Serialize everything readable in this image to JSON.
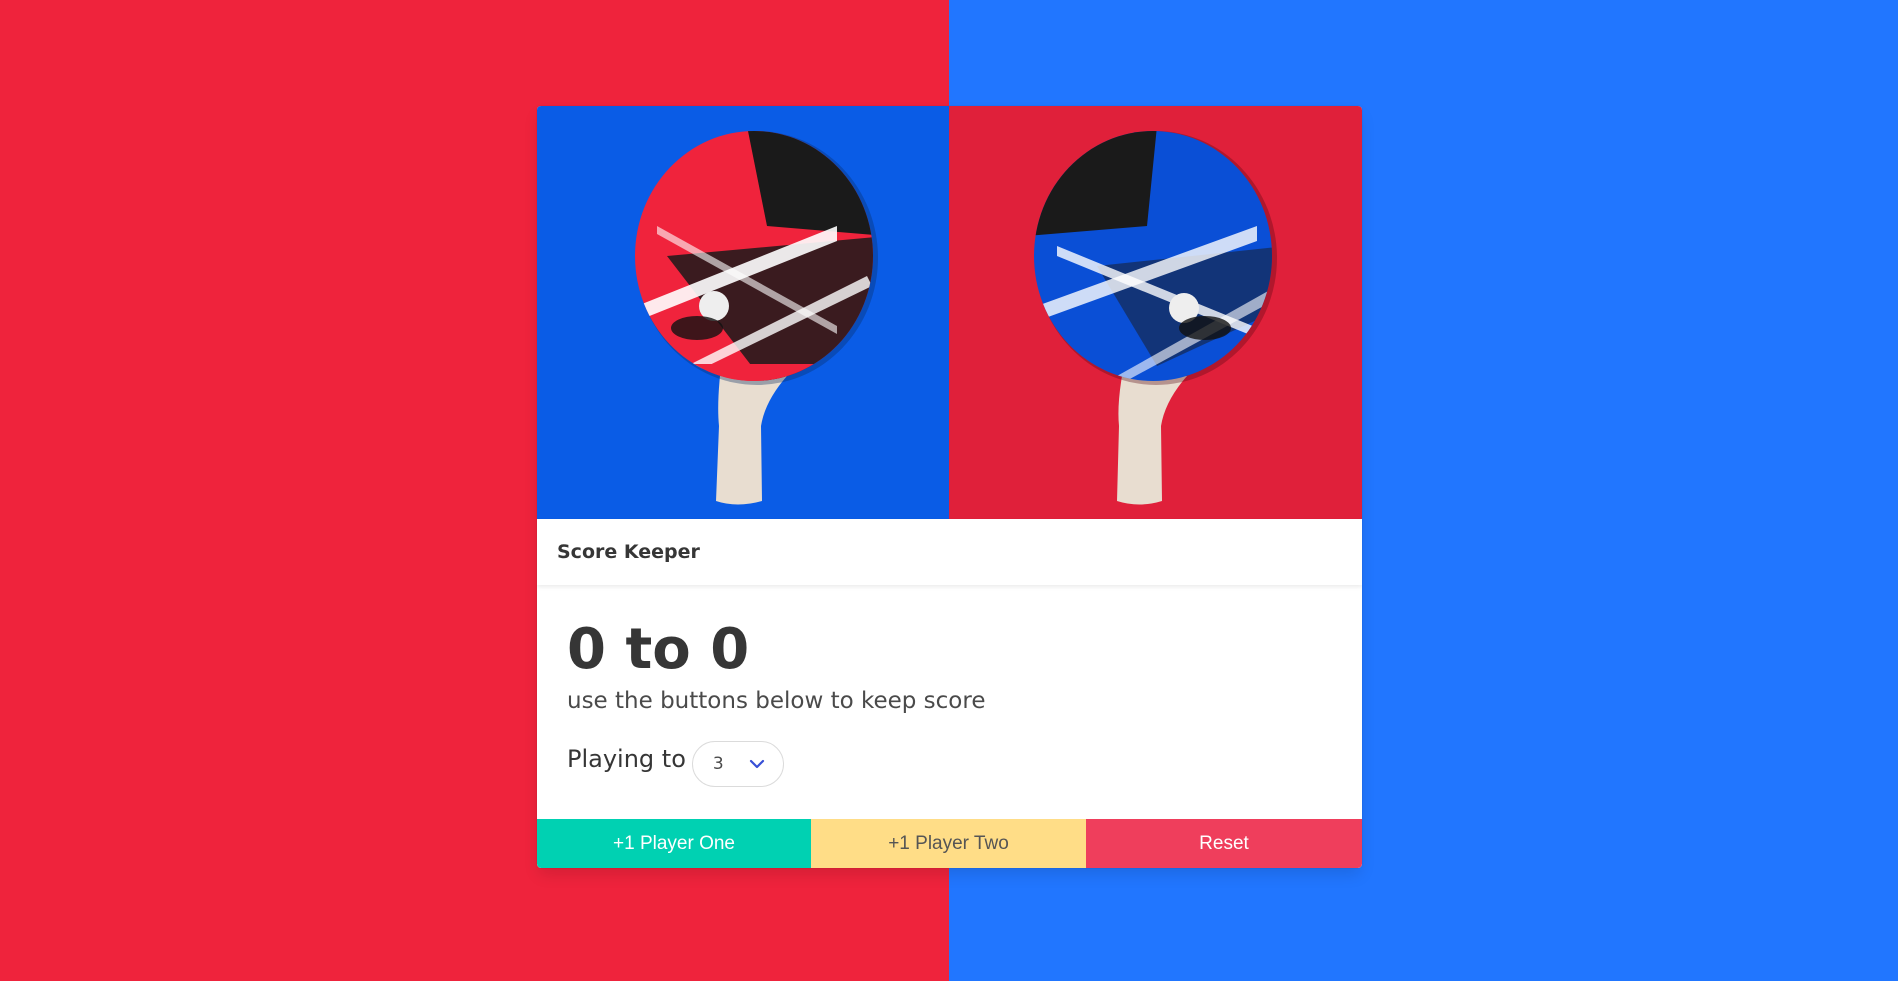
{
  "colors": {
    "left_bg": "#ef233c",
    "right_bg": "#2176ff",
    "player_one": "#00d1b2",
    "player_two": "#ffdd87",
    "reset": "#ef3e5c"
  },
  "card": {
    "image": "two ping pong paddles, red on blue and blue on red",
    "header_title": "Score Keeper"
  },
  "scoreboard": {
    "score_text": "0 to 0",
    "subtitle": "use the buttons below to keep score",
    "playing_to_label": "Playing to",
    "playing_to_value": "3"
  },
  "buttons": {
    "player_one": "+1 Player One",
    "player_two": "+1 Player Two",
    "reset": "Reset"
  }
}
